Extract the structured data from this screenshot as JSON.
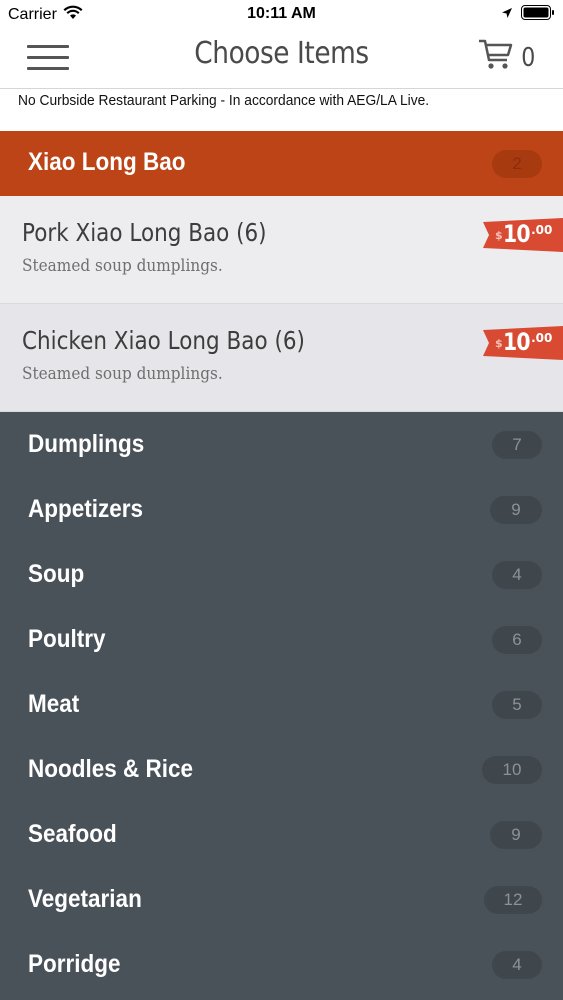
{
  "status_bar": {
    "carrier": "Carrier",
    "time": "10:11 AM"
  },
  "nav": {
    "title": "Choose Items",
    "cart_count": "0"
  },
  "notice": "No Curbside Restaurant Parking - In accordance with AEG/LA Live.",
  "active_category": {
    "name": "Xiao Long Bao",
    "count": "2"
  },
  "items": [
    {
      "name": "Pork Xiao Long Bao (6)",
      "description": "Steamed soup dumplings.",
      "price_symbol": "$",
      "price_main": "10",
      "price_cents": ".00"
    },
    {
      "name": "Chicken Xiao Long Bao (6)",
      "description": "Steamed soup dumplings.",
      "price_symbol": "$",
      "price_main": "10",
      "price_cents": ".00"
    }
  ],
  "categories": [
    {
      "name": "Dumplings",
      "count": "7"
    },
    {
      "name": "Appetizers",
      "count": "9"
    },
    {
      "name": "Soup",
      "count": "4"
    },
    {
      "name": "Poultry",
      "count": "6"
    },
    {
      "name": "Meat",
      "count": "5"
    },
    {
      "name": "Noodles & Rice",
      "count": "10"
    },
    {
      "name": "Seafood",
      "count": "9"
    },
    {
      "name": "Vegetarian",
      "count": "12"
    },
    {
      "name": "Porridge",
      "count": "4"
    }
  ],
  "colors": {
    "accent": "#bc4416",
    "price_tag": "#d84a31",
    "category_bg": "#4a5259",
    "item_bg_1": "#ededf0",
    "item_bg_2": "#e6e6ea"
  },
  "icons": [
    "wifi-icon",
    "location-icon",
    "battery-icon",
    "hamburger-menu-icon",
    "cart-icon"
  ]
}
